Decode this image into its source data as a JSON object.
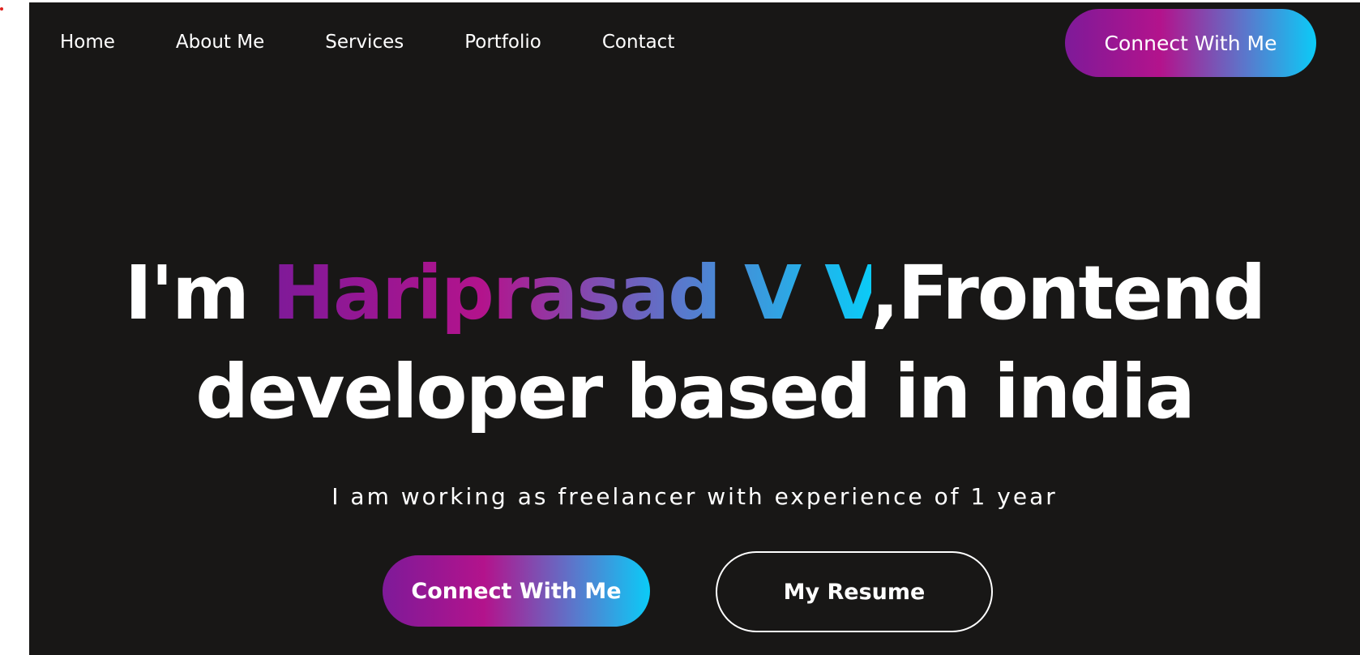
{
  "nav": {
    "items": [
      {
        "label": "Home"
      },
      {
        "label": "About Me"
      },
      {
        "label": "Services"
      },
      {
        "label": "Portfolio"
      },
      {
        "label": "Contact"
      }
    ],
    "cta_label": "Connect With Me"
  },
  "hero": {
    "title_prefix": "I'm ",
    "name": "Hariprasad V V",
    "title_suffix_line1": ",Frontend",
    "title_line2": "developer based in india",
    "subtitle": "I am working as freelancer with experience of 1 year",
    "primary_button": "Connect With Me",
    "secondary_button": "My Resume"
  },
  "colors": {
    "background": "#181716",
    "gradient_start": "#7e1a99",
    "gradient_mid": "#b3138c",
    "gradient_end": "#0bcbf7",
    "text": "#ffffff"
  }
}
